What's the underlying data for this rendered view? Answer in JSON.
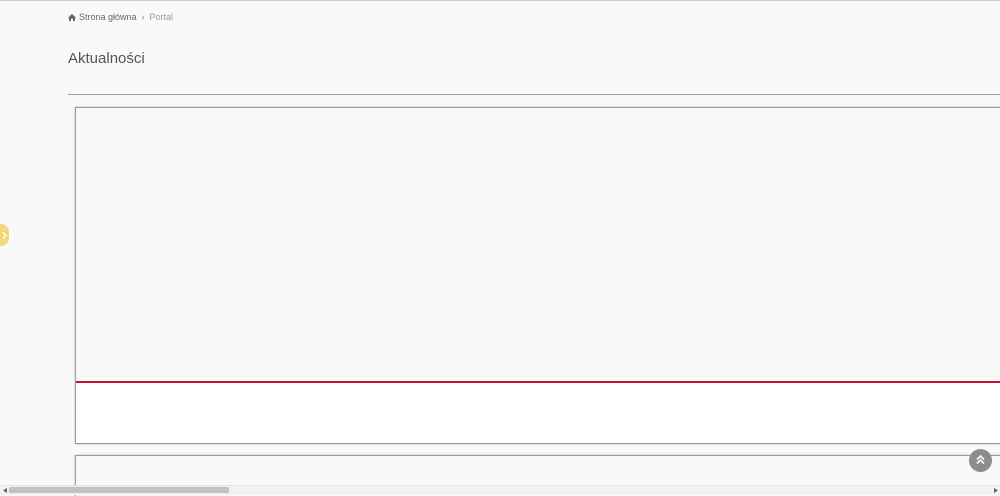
{
  "breadcrumb": {
    "home_label": "Strona główna",
    "current_label": "Portal"
  },
  "page": {
    "title": "Aktualności"
  },
  "colors": {
    "accent_red": "#c8102e",
    "side_tab_yellow": "#f5d77a"
  },
  "icons": {
    "home": "home-icon",
    "breadcrumb_separator": "chevron-right-icon",
    "side_tab": "chevron-right-icon",
    "scroll_top": "double-chevron-up-icon"
  }
}
